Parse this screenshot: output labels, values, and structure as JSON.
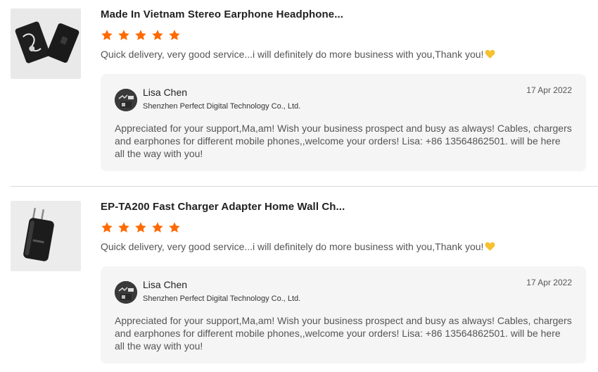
{
  "reviews": [
    {
      "product_title": "Made In Vietnam Stereo Earphone Headphone...",
      "rating": 5,
      "comment": "Quick delivery, very good service...i will definitely do more business with you,Thank you!",
      "comment_emoji": "heart-icon",
      "reply": {
        "seller_name": "Lisa Chen",
        "company": "Shenzhen Perfect Digital Technology Co., Ltd.",
        "date": "17 Apr 2022",
        "text": "Appreciated for your support,Ma,am! Wish your business prospect and busy as always! Cables, chargers and earphones for different mobile phones,,welcome your orders! Lisa: +86 13564862501. will be here all the way with you!"
      }
    },
    {
      "product_title": "EP-TA200 Fast Charger Adapter Home Wall Ch...",
      "rating": 5,
      "comment": "Quick delivery, very good service...i will definitely do more business with you,Thank you!",
      "comment_emoji": "heart-icon",
      "reply": {
        "seller_name": "Lisa Chen",
        "company": "Shenzhen Perfect Digital Technology Co., Ltd.",
        "date": "17 Apr 2022",
        "text": "Appreciated for your support,Ma,am! Wish your business prospect and busy as always! Cables, chargers and earphones for different mobile phones,,welcome your orders! Lisa: +86 13564862501. will be here all the way with you!"
      }
    }
  ],
  "colors": {
    "star": "#ff6a00",
    "heart": "#f5c12e",
    "reply_bg": "#f5f5f5"
  }
}
